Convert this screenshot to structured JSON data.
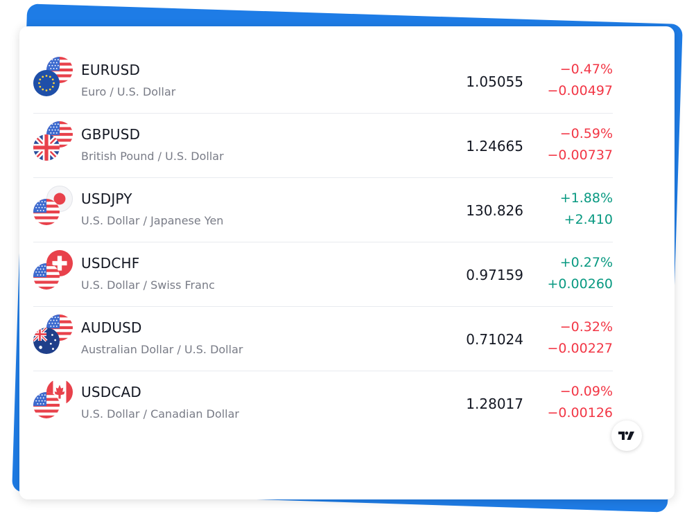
{
  "rows": [
    {
      "symbol": "EURUSD",
      "description": "Euro / U.S. Dollar",
      "price": "1.05055",
      "change_pct": "−0.47%",
      "change_abs": "−0.00497",
      "direction": "down",
      "front_flag": "eu-flag-icon",
      "back_flag": "us-flag-icon"
    },
    {
      "symbol": "GBPUSD",
      "description": "British Pound / U.S. Dollar",
      "price": "1.24665",
      "change_pct": "−0.59%",
      "change_abs": "−0.00737",
      "direction": "down",
      "front_flag": "uk-flag-icon",
      "back_flag": "us-flag-icon"
    },
    {
      "symbol": "USDJPY",
      "description": "U.S. Dollar / Japanese Yen",
      "price": "130.826",
      "change_pct": "+1.88%",
      "change_abs": "+2.410",
      "direction": "up",
      "front_flag": "us-flag-icon",
      "back_flag": "jp-flag-icon"
    },
    {
      "symbol": "USDCHF",
      "description": "U.S. Dollar / Swiss Franc",
      "price": "0.97159",
      "change_pct": "+0.27%",
      "change_abs": "+0.00260",
      "direction": "up",
      "front_flag": "us-flag-icon",
      "back_flag": "ch-flag-icon"
    },
    {
      "symbol": "AUDUSD",
      "description": "Australian Dollar / U.S. Dollar",
      "price": "0.71024",
      "change_pct": "−0.32%",
      "change_abs": "−0.00227",
      "direction": "down",
      "front_flag": "au-flag-icon",
      "back_flag": "us-flag-icon"
    },
    {
      "symbol": "USDCAD",
      "description": "U.S. Dollar / Canadian Dollar",
      "price": "1.28017",
      "change_pct": "−0.09%",
      "change_abs": "−0.00126",
      "direction": "down",
      "front_flag": "us-flag-icon",
      "back_flag": "ca-flag-icon"
    }
  ],
  "colors": {
    "negative": "#f23645",
    "positive": "#089981",
    "accent": "#1e7ce6"
  },
  "badge": {
    "icon": "tradingview-logo-icon"
  }
}
